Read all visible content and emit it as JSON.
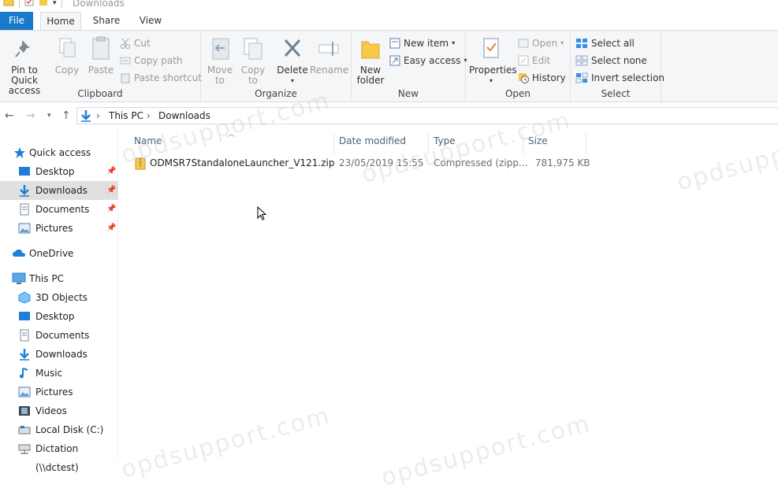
{
  "window": {
    "title": "Downloads"
  },
  "tabs": {
    "file": "File",
    "home": "Home",
    "share": "Share",
    "view": "View"
  },
  "ribbon": {
    "clipboard": {
      "label": "Clipboard",
      "pin": "Pin to Quick\naccess",
      "copy": "Copy",
      "paste": "Paste",
      "cut": "Cut",
      "copy_path": "Copy path",
      "paste_shortcut": "Paste shortcut"
    },
    "organize": {
      "label": "Organize",
      "move_to": "Move\nto",
      "copy_to": "Copy\nto",
      "delete": "Delete",
      "rename": "Rename"
    },
    "new": {
      "label": "New",
      "new_folder": "New\nfolder",
      "new_item": "New item",
      "easy_access": "Easy access"
    },
    "open": {
      "label": "Open",
      "properties": "Properties",
      "open": "Open",
      "edit": "Edit",
      "history": "History"
    },
    "select": {
      "label": "Select",
      "select_all": "Select all",
      "select_none": "Select none",
      "invert": "Invert selection"
    }
  },
  "address": {
    "crumbs": [
      "This PC",
      "Downloads"
    ]
  },
  "nav": {
    "quick_access": "Quick access",
    "quick_items": [
      "Desktop",
      "Downloads",
      "Documents",
      "Pictures"
    ],
    "onedrive": "OneDrive",
    "this_pc": "This PC",
    "pc_items": [
      "3D Objects",
      "Desktop",
      "Documents",
      "Downloads",
      "Music",
      "Pictures",
      "Videos",
      "Local Disk (C:)",
      "Dictation (\\\\dctest)"
    ]
  },
  "columns": {
    "name": "Name",
    "date": "Date modified",
    "type": "Type",
    "size": "Size"
  },
  "files": [
    {
      "name": "ODMSR7StandaloneLauncher_V121.zip",
      "date": "23/05/2019 15:55",
      "type": "Compressed (zipp...",
      "size": "781,975 KB"
    }
  ],
  "watermark": "opdsupport.com",
  "colors": {
    "file_tab": "#1979ca",
    "ribbon_bg": "#f5f6f7",
    "selected_nav": "#e0e0e0",
    "header_text": "#4c607a"
  }
}
